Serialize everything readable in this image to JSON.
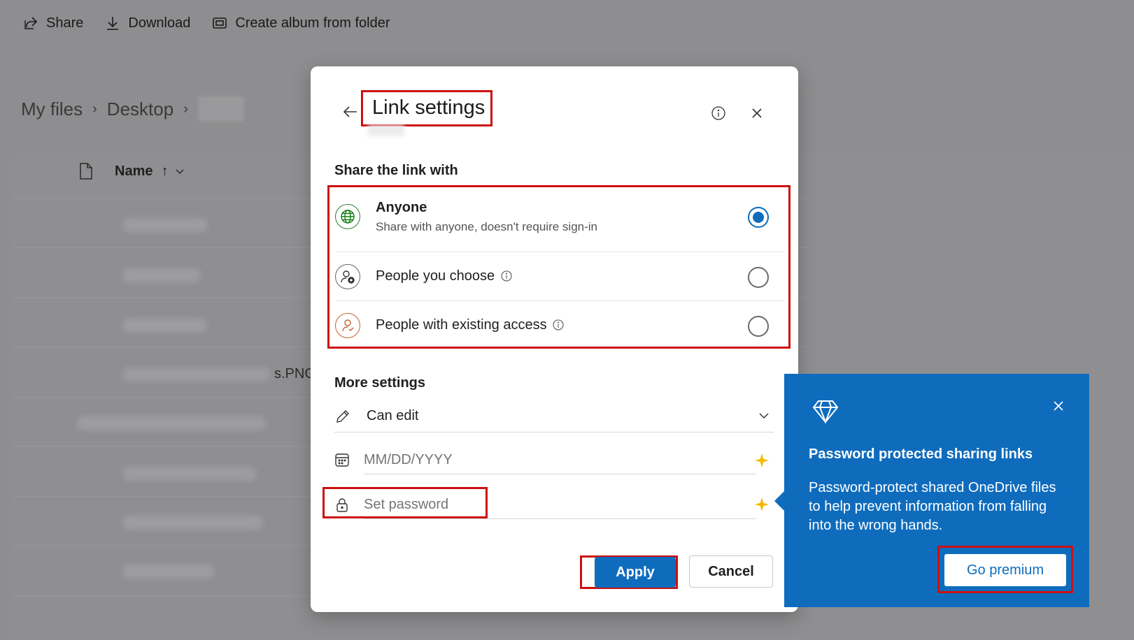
{
  "toolbar": {
    "share_label": "Share",
    "download_label": "Download",
    "create_album_label": "Create album from folder"
  },
  "breadcrumb": {
    "items": [
      "My files",
      "Desktop"
    ]
  },
  "file_list": {
    "name_header": "Name",
    "sort_indicator": "↑",
    "partial_file_text": "s.PNG"
  },
  "dialog": {
    "title": "Link settings",
    "share_section_label": "Share the link with",
    "options": [
      {
        "title": "Anyone",
        "subtitle": "Share with anyone, doesn't require sign-in",
        "selected": true,
        "icon": "globe-icon"
      },
      {
        "title": "People you choose",
        "selected": false,
        "icon": "person-add-icon"
      },
      {
        "title": "People with existing access",
        "selected": false,
        "icon": "person-check-icon"
      }
    ],
    "more_settings_label": "More settings",
    "permission_value": "Can edit",
    "expiration_placeholder": "MM/DD/YYYY",
    "password_placeholder": "Set password",
    "apply_label": "Apply",
    "cancel_label": "Cancel"
  },
  "premium_bubble": {
    "title": "Password protected sharing links",
    "body": "Password-protect shared OneDrive files to help prevent information from falling into the wrong hands.",
    "button_label": "Go premium"
  },
  "colors": {
    "accent": "#0f6cbd",
    "highlight_border": "#cc1010",
    "premium_spark": "#f5b800",
    "globe_green": "#107c10",
    "person_orange": "#c4622d"
  }
}
